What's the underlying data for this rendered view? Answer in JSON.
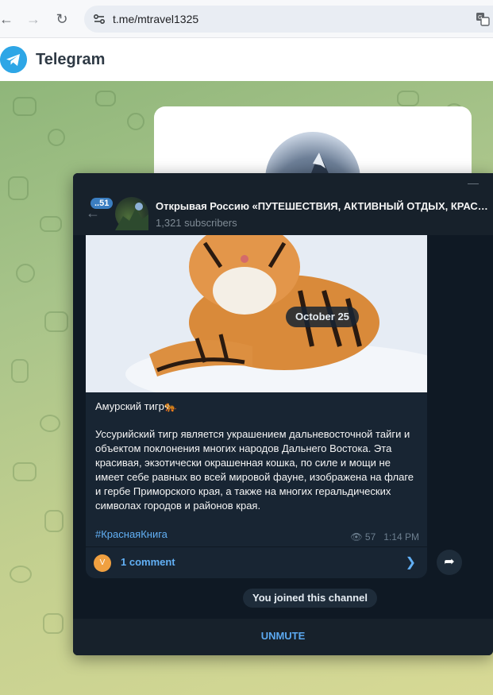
{
  "browser": {
    "url": "t.me/mtravel1325"
  },
  "telegram_header": {
    "title": "Telegram"
  },
  "chat": {
    "unread_badge": "..51",
    "channel_name": "Открывая Россию «ПУТЕШЕСТВИЯ, АКТИВНЫЙ ОТДЫХ, КРАСИ...",
    "subscribers": "1,321 subscribers"
  },
  "message": {
    "date": "October 25",
    "title": "Амурский тигр🐅",
    "body": "Уссурийский тигр является украшением дальневосточной тайги и объектом поклонения многих народов Дальнего Востока. Эта красивая, экзотически окрашенная кошка, по силе и мощи не имеет себе равных во всей мировой фауне, изображена на флаге и гербе Приморского края, а также на многих геральдических символах городов и районов края.",
    "hashtag": "#КраснаяКнига",
    "views": "57",
    "time": "1:14 PM",
    "comment_avatar": "V",
    "comments_label": "1 comment"
  },
  "service": {
    "joined": "You joined this channel"
  },
  "bottom": {
    "unmute": "UNMUTE"
  },
  "colors": {
    "accent": "#5ba8ef",
    "dark_bg": "#0f1924",
    "bubble": "#182533"
  }
}
